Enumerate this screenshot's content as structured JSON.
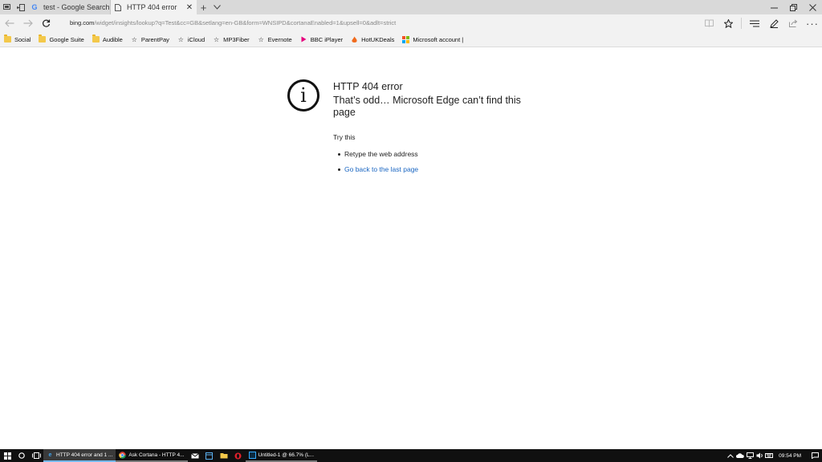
{
  "tabs": [
    {
      "title": "test - Google Search",
      "favicon": "G"
    },
    {
      "title": "HTTP 404 error",
      "favicon": ""
    }
  ],
  "address": {
    "host": "bing.com",
    "path": "/widget/insights/lookup?q=Test&cc=GB&setlang=en-GB&form=WNSIPD&cortanaEnabled=1&upsell=0&adlt=strict"
  },
  "favorites": [
    {
      "label": "Social",
      "icon": "folder-icon"
    },
    {
      "label": "Google Suite",
      "icon": "folder-icon"
    },
    {
      "label": "Audible",
      "icon": "folder-icon"
    },
    {
      "label": "ParentPay",
      "icon": "star-icon"
    },
    {
      "label": "iCloud",
      "icon": "star-icon"
    },
    {
      "label": "MP3Fiber",
      "icon": "star-icon"
    },
    {
      "label": "Evernote",
      "icon": "star-icon"
    },
    {
      "label": "BBC iPlayer",
      "icon": "bbc-iplayer-icon"
    },
    {
      "label": "HotUKDeals",
      "icon": "hotukdeals-icon"
    },
    {
      "label": "Microsoft account |",
      "icon": "microsoft-icon"
    }
  ],
  "error": {
    "code": "HTTP 404 error",
    "message": "That’s odd… Microsoft Edge can’t find this page",
    "try_this": "Try this",
    "suggestions": [
      "Retype the web address",
      "Go back to the last page"
    ]
  },
  "taskbar": {
    "apps": [
      {
        "label": "HTTP 404 error and 1 ...",
        "icon": "edge-icon"
      },
      {
        "label": "Ask Cortana - HTTP 4...",
        "icon": "chrome-icon"
      }
    ],
    "last_app": "Untitled-1 @ 66.7% (L...",
    "clock": "09:54 PM"
  },
  "colors": {
    "link": "#1a66c2",
    "chrome_bg": "#f2f2f2",
    "tabstrip_bg": "#d9d9d9",
    "taskbar_bg": "#101010",
    "accent": "#76b9ed"
  }
}
